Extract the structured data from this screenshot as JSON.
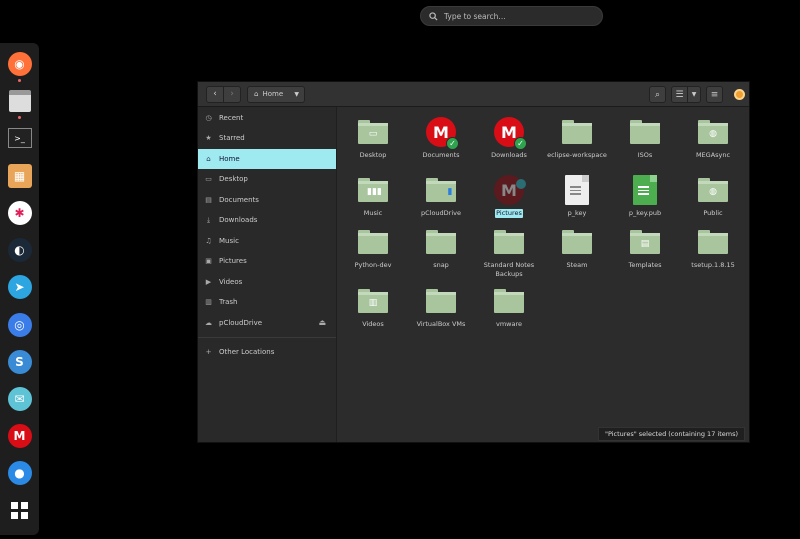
{
  "search": {
    "placeholder": "Type to search..."
  },
  "dock": {
    "apps": [
      {
        "name": "firefox",
        "color": "#ff7139"
      },
      {
        "name": "files",
        "color": "#dcdcdc"
      },
      {
        "name": "terminal",
        "color": "#222"
      },
      {
        "name": "archive",
        "color": "#e8a55a"
      },
      {
        "name": "slack",
        "color": "#fff"
      },
      {
        "name": "steam",
        "color": "#1b2838"
      },
      {
        "name": "telegram",
        "color": "#2ca5e0"
      },
      {
        "name": "chromium",
        "color": "#3b7de8"
      },
      {
        "name": "simplenote",
        "color": "#3a8bd6"
      },
      {
        "name": "mail",
        "color": "#5fc3d6"
      },
      {
        "name": "mega",
        "color": "#d80d16"
      },
      {
        "name": "signal",
        "color": "#2a8ae6"
      },
      {
        "name": "app-grid",
        "color": "#fff"
      }
    ]
  },
  "header": {
    "path_label": "Home"
  },
  "sidebar": {
    "items": [
      {
        "label": "Recent",
        "icon": "clock"
      },
      {
        "label": "Starred",
        "icon": "star"
      },
      {
        "label": "Home",
        "icon": "home",
        "selected": true
      },
      {
        "label": "Desktop",
        "icon": "desktop"
      },
      {
        "label": "Documents",
        "icon": "document"
      },
      {
        "label": "Downloads",
        "icon": "download"
      },
      {
        "label": "Music",
        "icon": "music"
      },
      {
        "label": "Pictures",
        "icon": "picture"
      },
      {
        "label": "Videos",
        "icon": "video"
      },
      {
        "label": "Trash",
        "icon": "trash"
      },
      {
        "label": "pCloudDrive",
        "icon": "drive"
      }
    ],
    "other_locations": "Other Locations"
  },
  "files": [
    {
      "label": "Desktop",
      "kind": "folder",
      "emblem": "desktop"
    },
    {
      "label": "Documents",
      "kind": "mega"
    },
    {
      "label": "Downloads",
      "kind": "mega"
    },
    {
      "label": "eclipse-workspace",
      "kind": "folder"
    },
    {
      "label": "ISOs",
      "kind": "folder"
    },
    {
      "label": "MEGAsync",
      "kind": "folder",
      "emblem": "globe"
    },
    {
      "label": "Music",
      "kind": "folder",
      "emblem": "music"
    },
    {
      "label": "pCloudDrive",
      "kind": "folder",
      "emblem": "drive"
    },
    {
      "label": "Pictures",
      "kind": "mega-dark",
      "selected": true
    },
    {
      "label": "p_key",
      "kind": "doc"
    },
    {
      "label": "p_key.pub",
      "kind": "doc-green"
    },
    {
      "label": "Public",
      "kind": "folder",
      "emblem": "globe"
    },
    {
      "label": "Python-dev",
      "kind": "folder"
    },
    {
      "label": "snap",
      "kind": "folder"
    },
    {
      "label": "Standard Notes Backups",
      "kind": "folder"
    },
    {
      "label": "Steam",
      "kind": "folder"
    },
    {
      "label": "Templates",
      "kind": "folder",
      "emblem": "template"
    },
    {
      "label": "tsetup.1.8.15",
      "kind": "folder"
    },
    {
      "label": "Videos",
      "kind": "folder",
      "emblem": "video"
    },
    {
      "label": "VirtualBox VMs",
      "kind": "folder"
    },
    {
      "label": "vmware",
      "kind": "folder"
    }
  ],
  "status": "\"Pictures\" selected (containing 17 items)"
}
